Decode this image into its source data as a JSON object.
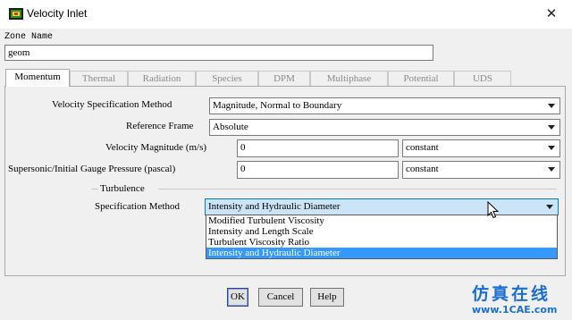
{
  "window": {
    "title": "Velocity Inlet",
    "close_glyph": "✕",
    "icon": "fluent-app-icon"
  },
  "zone": {
    "label": "Zone Name",
    "value": "geom"
  },
  "tabs": [
    {
      "label": "Momentum",
      "active": true
    },
    {
      "label": "Thermal"
    },
    {
      "label": "Radiation"
    },
    {
      "label": "Species"
    },
    {
      "label": "DPM"
    },
    {
      "label": "Multiphase"
    },
    {
      "label": "Potential"
    },
    {
      "label": "UDS"
    }
  ],
  "momentum": {
    "velocity_spec": {
      "label": "Velocity Specification Method",
      "value": "Magnitude, Normal to Boundary"
    },
    "reference_frame": {
      "label": "Reference Frame",
      "value": "Absolute"
    },
    "velocity_magnitude": {
      "label": "Velocity Magnitude (m/s)",
      "value": "0",
      "profile": "constant"
    },
    "gauge_pressure": {
      "label": "Supersonic/Initial Gauge Pressure (pascal)",
      "value": "0",
      "profile": "constant"
    },
    "turbulence": {
      "group_label": "Turbulence",
      "spec_label": "Specification Method",
      "spec_value": "Intensity and Hydraulic Diameter",
      "options": [
        "Modified Turbulent Viscosity",
        "Intensity and Length Scale",
        "Turbulent Viscosity Ratio",
        "Intensity and Hydraulic Diameter"
      ],
      "selected_option_index": 3
    }
  },
  "buttons": {
    "ok": "OK",
    "cancel": "Cancel",
    "help": "Help"
  },
  "watermark": {
    "top": "仿真在线",
    "bottom": "www.1CAE.com"
  },
  "colors": {
    "selection": "#3399ff",
    "combo_highlight": "#cce4f7",
    "watermark": "#1a6fd6"
  }
}
